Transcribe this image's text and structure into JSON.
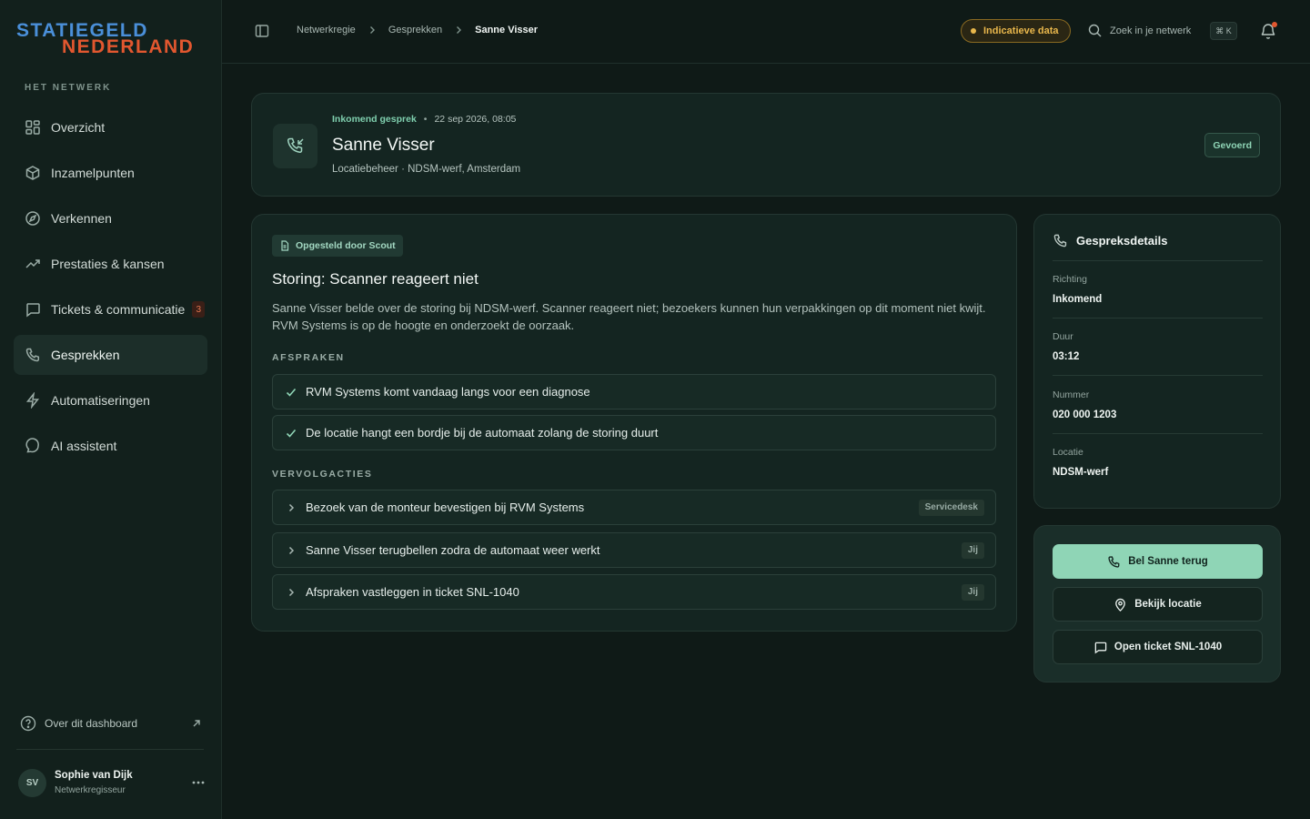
{
  "brand": {
    "line1": "STATIEGELD",
    "line2": "NEDERLAND",
    "color_primary": "#4a8fd9",
    "color_secondary": "#e2572f"
  },
  "sidebar": {
    "section_label": "HET NETWERK",
    "items": [
      {
        "label": "Overzicht",
        "icon": "grid-icon"
      },
      {
        "label": "Inzamelpunten",
        "icon": "box-icon"
      },
      {
        "label": "Verkennen",
        "icon": "compass-icon"
      },
      {
        "label": "Prestaties & kansen",
        "icon": "trending-up-icon"
      },
      {
        "label": "Tickets & communicatie",
        "icon": "message-square-icon",
        "badge": "3"
      },
      {
        "label": "Gesprekken",
        "icon": "phone-icon",
        "active": true
      },
      {
        "label": "Automatiseringen",
        "icon": "zap-icon"
      },
      {
        "label": "AI assistent",
        "icon": "message-circle-icon"
      }
    ],
    "about_label": "Over dit dashboard",
    "user": {
      "initials": "SV",
      "name": "Sophie van Dijk",
      "role": "Netwerkregisseur"
    }
  },
  "topbar": {
    "breadcrumbs": [
      "Netwerkregie",
      "Gesprekken",
      "Sanne Visser"
    ],
    "data_pill": "Indicatieve data",
    "search_placeholder": "Zoek in je netwerk",
    "shortcut": "⌘ K"
  },
  "call": {
    "type": "Inkomend gesprek",
    "date": "22 sep 2026, 08:05",
    "name": "Sanne Visser",
    "subtitle": "Locatiebeheer · NDSM-werf, Amsterdam",
    "status": "Gevoerd"
  },
  "summary": {
    "tag": "Opgesteld door Scout",
    "title": "Storing: Scanner reageert niet",
    "text": "Sanne Visser belde over de storing bij NDSM-werf. Scanner reageert niet; bezoekers kunnen hun verpakkingen op dit moment niet kwijt. RVM Systems is op de hoogte en onderzoekt de oorzaak.",
    "agreements_label": "AFSPRAKEN",
    "agreements": [
      "RVM Systems komt vandaag langs voor een diagnose",
      "De locatie hangt een bordje bij de automaat zolang de storing duurt"
    ],
    "followups_label": "VERVOLGACTIES",
    "followups": [
      {
        "text": "Bezoek van de monteur bevestigen bij RVM Systems",
        "owner": "Servicedesk"
      },
      {
        "text": "Sanne Visser terugbellen zodra de automaat weer werkt",
        "owner": "Jij"
      },
      {
        "text": "Afspraken vastleggen in ticket SNL-1040",
        "owner": "Jij"
      }
    ]
  },
  "details": {
    "title": "Gespreksdetails",
    "fields": [
      {
        "label": "Richting",
        "value": "Inkomend"
      },
      {
        "label": "Duur",
        "value": "03:12"
      },
      {
        "label": "Nummer",
        "value": "020 000 1203"
      },
      {
        "label": "Locatie",
        "value": "NDSM-werf"
      }
    ]
  },
  "actions": {
    "call_back": "Bel Sanne terug",
    "view_location": "Bekijk locatie",
    "open_ticket": "Open ticket SNL-1040"
  },
  "colors": {
    "accent": "#8fd5b6",
    "warning": "#e9b74c",
    "background": "#0f1a17"
  }
}
